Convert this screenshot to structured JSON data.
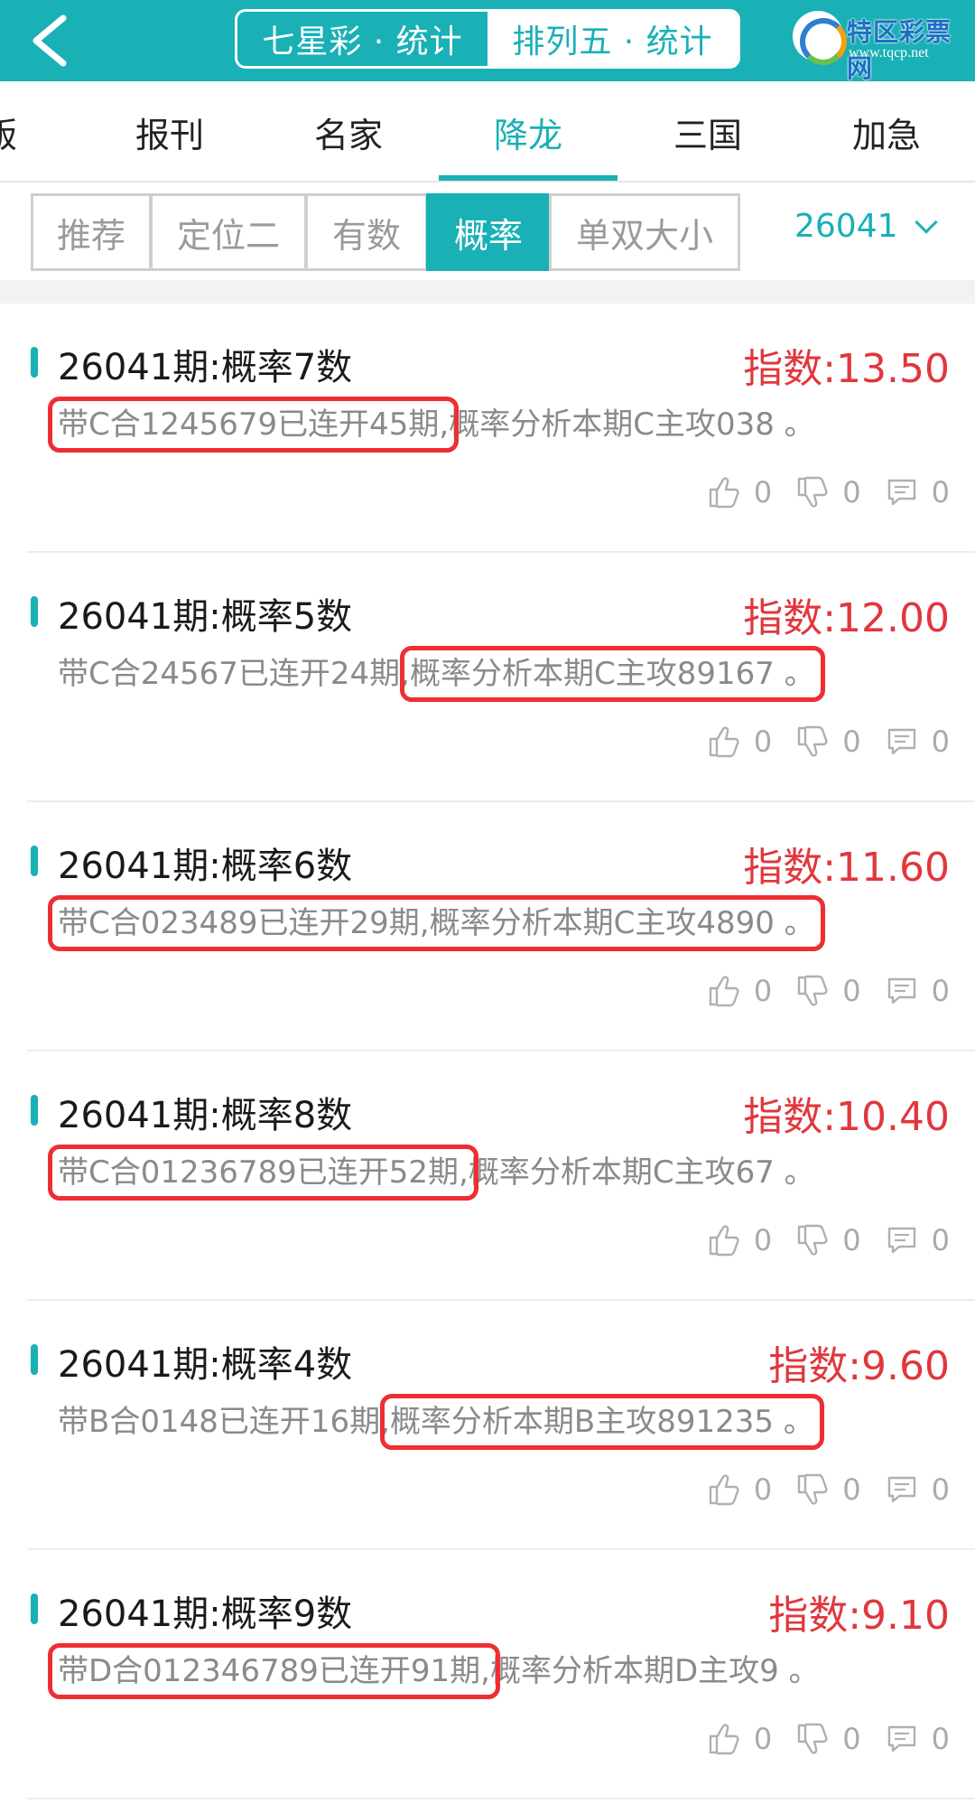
{
  "header": {
    "back_icon": "chevron-left-icon",
    "seg_left": "七星彩 · 统计",
    "seg_right": "排列五 · 统计",
    "logo_text": "特区彩票网",
    "logo_url": "www.tqcp.net"
  },
  "tabs": [
    {
      "label": "版",
      "active": false
    },
    {
      "label": "报刊",
      "active": false
    },
    {
      "label": "名家",
      "active": false
    },
    {
      "label": "降龙",
      "active": true
    },
    {
      "label": "三国",
      "active": false
    },
    {
      "label": "加急",
      "active": false
    }
  ],
  "filters": [
    {
      "label": "推荐",
      "active": false
    },
    {
      "label": "定位二",
      "active": false
    },
    {
      "label": "有数",
      "active": false
    },
    {
      "label": "概率",
      "active": true
    },
    {
      "label": "单双大小",
      "active": false
    }
  ],
  "period": "26041",
  "colors": {
    "accent": "#19b0b6",
    "index": "#e0373d",
    "highlight": "#ee2e33"
  },
  "cards": [
    {
      "title": "26041期:概率7数",
      "index": "指数:13.50",
      "desc_a": "带C合1245679已连开45期,",
      "desc_b": "概率分析本期C主攻038 。",
      "highlight": "a",
      "likes": "0",
      "dislikes": "0",
      "comments": "0"
    },
    {
      "title": "26041期:概率5数",
      "index": "指数:12.00",
      "desc_a": "带C合24567已连开24期,",
      "desc_b": "概率分析本期C主攻89167 。",
      "highlight": "b",
      "likes": "0",
      "dislikes": "0",
      "comments": "0"
    },
    {
      "title": "26041期:概率6数",
      "index": "指数:11.60",
      "desc_a": "带C合023489已连开29期,",
      "desc_b": "概率分析本期C主攻4890 。",
      "highlight": "both",
      "likes": "0",
      "dislikes": "0",
      "comments": "0"
    },
    {
      "title": "26041期:概率8数",
      "index": "指数:10.40",
      "desc_a": "带C合01236789已连开52期,",
      "desc_b": "概率分析本期C主攻67 。",
      "highlight": "a",
      "likes": "0",
      "dislikes": "0",
      "comments": "0"
    },
    {
      "title": "26041期:概率4数",
      "index": "指数:9.60",
      "desc_a": "带B合0148已连开16期,",
      "desc_b": "概率分析本期B主攻891235 。",
      "highlight": "b",
      "likes": "0",
      "dislikes": "0",
      "comments": "0"
    },
    {
      "title": "26041期:概率9数",
      "index": "指数:9.10",
      "desc_a": "带D合012346789已连开91期,",
      "desc_b": "概率分析本期D主攻9 。",
      "highlight": "a",
      "likes": "0",
      "dislikes": "0",
      "comments": "0"
    }
  ]
}
